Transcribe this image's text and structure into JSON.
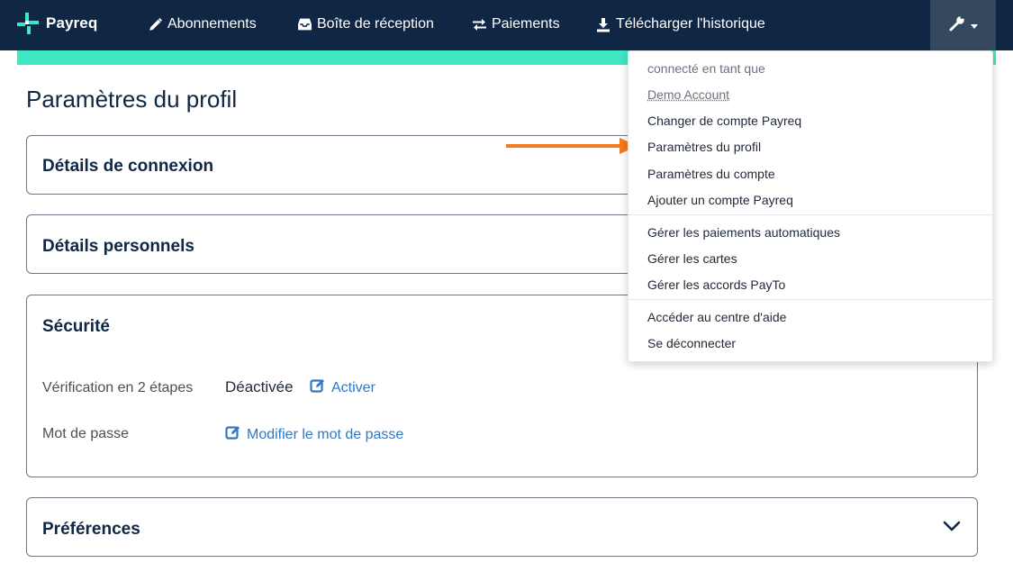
{
  "brand": {
    "name": "Payreq",
    "logo_color": "#3ee6c1"
  },
  "nav": {
    "items": [
      {
        "label": "Abonnements",
        "icon": "pencil-icon"
      },
      {
        "label": "Boîte de réception",
        "icon": "inbox-icon"
      },
      {
        "label": "Paiements",
        "icon": "swap-arrows-icon"
      },
      {
        "label": "Télécharger l'historique",
        "icon": "download-icon"
      }
    ],
    "tools_icon": "wrench-icon",
    "background": "#0f2744",
    "accent": "#3ee6c1"
  },
  "page": {
    "title": "Paramètres du profil"
  },
  "cards": {
    "login": {
      "title": "Détails de connexion"
    },
    "personal": {
      "title": "Détails personnels"
    },
    "security": {
      "title": "Sécurité",
      "two_step_label": "Vérification en 2 étapes",
      "two_step_status": "Déactivée",
      "two_step_action": "Activer",
      "password_label": "Mot de passe",
      "password_action": "Modifier le mot de passe"
    },
    "preferences": {
      "title": "Préférences"
    }
  },
  "dropdown": {
    "signed_in_label": "connecté en tant que",
    "account_name": "Demo Account",
    "group1": [
      "Changer de compte Payreq",
      "Paramètres du profil",
      "Paramètres du compte",
      "Ajouter un compte Payreq"
    ],
    "group2": [
      "Gérer les paiements automatiques",
      "Gérer les cartes",
      "Gérer les accords PayTo"
    ],
    "group3": [
      "Accéder au centre d'aide",
      "Se déconnecter"
    ]
  },
  "colors": {
    "link": "#2f78c4",
    "annotation_arrow": "#f47a20"
  }
}
